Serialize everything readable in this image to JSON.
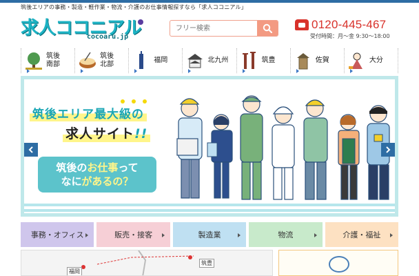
{
  "header": {
    "tagline": "筑後エリアの事務・製造・軽作業・物流・介護のお仕事情報探すなら「求人ココニアル」",
    "logo_main": "求人ココニアル",
    "logo_sub": "cocoaru.jp",
    "search_placeholder": "フリー検索",
    "phone_number": "0120-445-467",
    "hours": "受付時間：月～金 9:30～18:00"
  },
  "nav": {
    "items": [
      {
        "label": "筑後\n南部",
        "icon": "tree-icon",
        "color": "#3a8a3a"
      },
      {
        "label": "筑後\n北部",
        "icon": "ramen-icon",
        "color": "#b86a2a"
      },
      {
        "label": "福岡",
        "icon": "tower-icon",
        "color": "#2a4a8a"
      },
      {
        "label": "北九州",
        "icon": "castle-icon",
        "color": "#555555"
      },
      {
        "label": "筑豊",
        "icon": "chimney-icon",
        "color": "#8a3a2a"
      },
      {
        "label": "佐賀",
        "icon": "watchtower-icon",
        "color": "#6a5a3a"
      },
      {
        "label": "大分",
        "icon": "doll-icon",
        "color": "#c85a5a"
      }
    ]
  },
  "hero": {
    "headline1": "筑後エリア最大級の",
    "headline2_main": "求人サイト",
    "headline2_accent": "!!",
    "bubble_line1_pre": "筑後の",
    "bubble_line1_hl": "お仕事",
    "bubble_line1_post": "って",
    "bubble_line2_pre": "なに",
    "bubble_line2_hl": "があるの？",
    "bubble_line2_post": ""
  },
  "categories": [
    {
      "label": "事務・オフィス",
      "color": "#cfc6ec"
    },
    {
      "label": "販売・接客",
      "color": "#f6cfd6"
    },
    {
      "label": "製造業",
      "color": "#bfe0f2"
    },
    {
      "label": "物流",
      "color": "#c8eacb"
    },
    {
      "label": "介護・福祉",
      "color": "#fde1c2"
    }
  ],
  "map": {
    "labels": [
      "福岡",
      "筑豊"
    ]
  },
  "colors": {
    "accent": "#1aa6b5",
    "brand_blue": "#2e6da4",
    "phone_red": "#d8312a",
    "search_salmon": "#f39a82"
  }
}
